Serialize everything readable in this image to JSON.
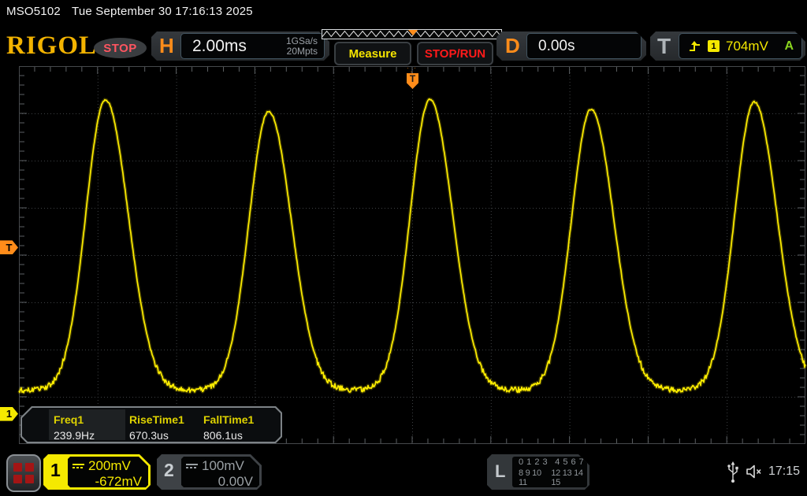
{
  "header": {
    "model": "MSO5102",
    "datetime": "Tue September 30 17:16:13 2025"
  },
  "toolbar": {
    "brand": "RIGOL",
    "acq_status": "STOP",
    "horizontal": {
      "label": "H",
      "timebase": "2.00ms",
      "sample_rate": "1GSa/s",
      "memory_depth": "20Mpts"
    },
    "measure_label": "Measure",
    "stop_run_label": "STOP/RUN",
    "delay": {
      "label": "D",
      "value": "0.00s"
    },
    "trigger": {
      "label": "T",
      "source": "1",
      "level": "704mV",
      "mode": "A"
    }
  },
  "plot_markers": {
    "trigger_top": "T",
    "trigger_left": "T",
    "ch1_ground": "1"
  },
  "measurements": {
    "items": [
      {
        "label": "Freq1",
        "value": "239.9Hz"
      },
      {
        "label": "RiseTime1",
        "value": "670.3us"
      },
      {
        "label": "FallTime1",
        "value": "806.1us"
      }
    ]
  },
  "channels": {
    "ch1": {
      "number": "1",
      "scale": "200mV",
      "offset": "-672mV"
    },
    "ch2": {
      "number": "2",
      "scale": "100mV",
      "offset": "0.00V"
    }
  },
  "digital": {
    "label": "L",
    "row1a": "0 1 2 3",
    "row1b": "4 5 6 7",
    "row2a": "8 9 10 11",
    "row2b": "12 13 14 15"
  },
  "statusbar": {
    "time": "17:15"
  },
  "colors": {
    "accent_orange": "#ff8c1a",
    "channel1_yellow": "#f5e900",
    "waveform_yellow": "#ffee00",
    "trigger_mode_green": "#8ad41f",
    "stop_run_red": "#ff1a1a",
    "brand_gold": "#f3b300",
    "grid_line": "#3e4144",
    "grid_border": "#46494c"
  },
  "chart_data": {
    "type": "line",
    "title": "CH1 pulse train (Gaussian-shaped pulses)",
    "x_units": "ms",
    "y_units": "V",
    "time_per_div_ms": 2,
    "volts_per_div": 0.2,
    "h_divisions": 10,
    "v_divisions": 8,
    "x_range_ms": [
      -10,
      10
    ],
    "baseline_v": 0.1,
    "peaks": [
      {
        "t_ms": -7.8,
        "v": 1.33
      },
      {
        "t_ms": -3.65,
        "v": 1.28
      },
      {
        "t_ms": 0.45,
        "v": 1.33
      },
      {
        "t_ms": 4.55,
        "v": 1.29
      },
      {
        "t_ms": 8.7,
        "v": 1.32
      }
    ],
    "sigma_rise_ms": 0.5,
    "sigma_fall_ms": 0.58,
    "noise_vpp": 0.016,
    "trigger_level_v": 0.704,
    "trigger_delay_s": "0.00s",
    "ch1_offset_v": -0.672,
    "measured": {
      "freq_hz": 239.9,
      "rise_time_us": 670.3,
      "fall_time_us": 806.1
    }
  }
}
